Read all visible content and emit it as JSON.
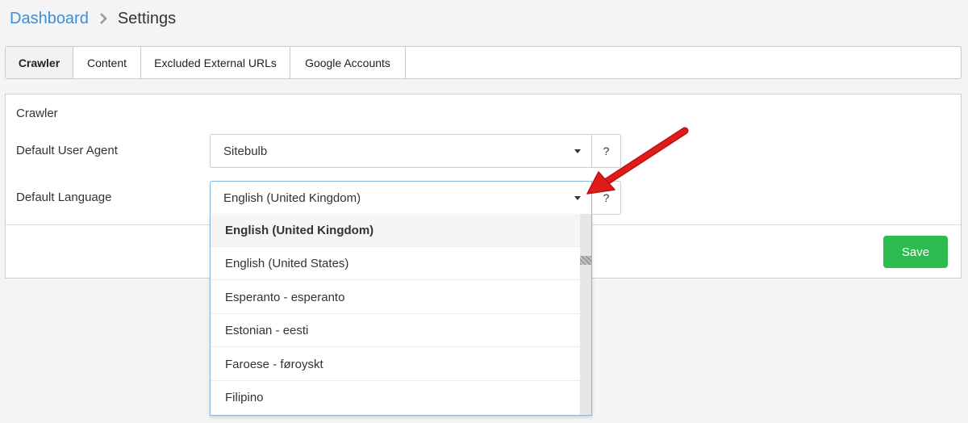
{
  "breadcrumb": {
    "root": "Dashboard",
    "current": "Settings"
  },
  "tabs": [
    {
      "label": "Crawler",
      "active": true
    },
    {
      "label": "Content",
      "active": false
    },
    {
      "label": "Excluded External URLs",
      "active": false
    },
    {
      "label": "Google Accounts",
      "active": false
    }
  ],
  "section": {
    "title": "Crawler"
  },
  "fields": {
    "user_agent": {
      "label": "Default User Agent",
      "value": "Sitebulb",
      "help": "?"
    },
    "language": {
      "label": "Default Language",
      "value": "English (United Kingdom)",
      "help": "?"
    }
  },
  "language_options": [
    {
      "label": "English (United Kingdom)",
      "selected": true
    },
    {
      "label": "English (United States)",
      "selected": false
    },
    {
      "label": "Esperanto - esperanto",
      "selected": false
    },
    {
      "label": "Estonian - eesti",
      "selected": false
    },
    {
      "label": "Faroese - føroyskt",
      "selected": false
    },
    {
      "label": "Filipino",
      "selected": false
    }
  ],
  "save_label": "Save",
  "colors": {
    "link": "#3a8fd6",
    "save": "#2dba4e",
    "annotation_arrow": "#e01b1b"
  },
  "icons": {
    "breadcrumb_separator": "chevron-right-icon",
    "select_caret": "caret-down-icon",
    "annotation": "red-arrow-icon"
  }
}
